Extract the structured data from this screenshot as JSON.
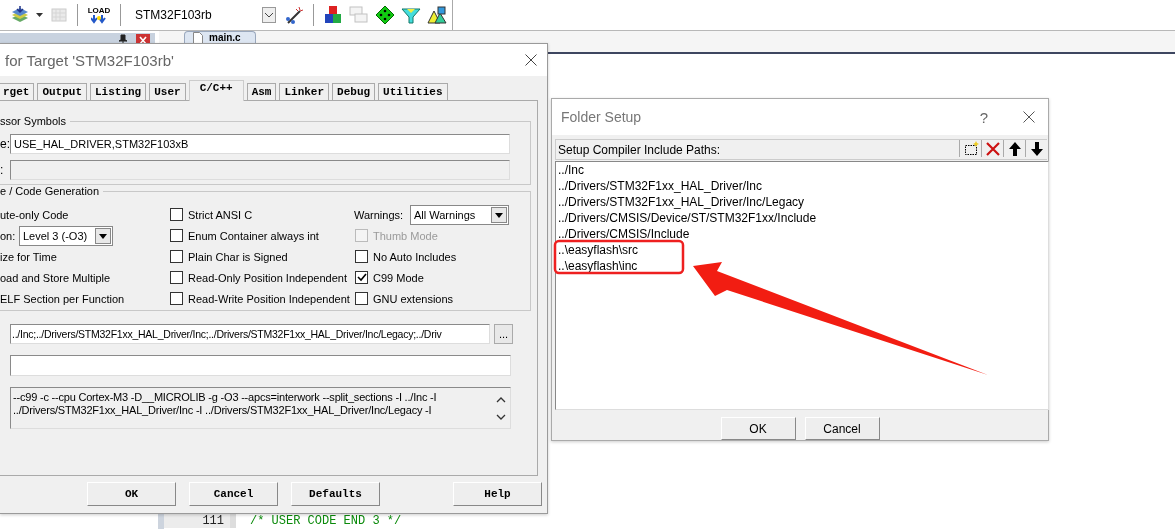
{
  "toolbar": {
    "load_label": "LOAD",
    "device": "STM32F103rb"
  },
  "editor": {
    "tabs": [
      {
        "label": "main.c"
      }
    ],
    "lines": [
      {
        "number": "111",
        "code": "/* USER CODE END 3 */"
      }
    ]
  },
  "options_dialog": {
    "title": "for Target 'STM32F103rb'",
    "tabs": [
      {
        "label": "rget",
        "selected": false
      },
      {
        "label": "Output",
        "selected": false
      },
      {
        "label": "Listing",
        "selected": false
      },
      {
        "label": "User",
        "selected": false
      },
      {
        "label": "C/C++",
        "selected": true
      },
      {
        "label": "Asm",
        "selected": false
      },
      {
        "label": "Linker",
        "selected": false
      },
      {
        "label": "Debug",
        "selected": false
      },
      {
        "label": "Utilities",
        "selected": false
      }
    ],
    "preprocessor": {
      "title": "ssor Symbols",
      "fields": [
        {
          "label": "e:",
          "value": "USE_HAL_DRIVER,STM32F103xB",
          "disabled": false
        },
        {
          "label": ":",
          "disabled": true
        }
      ]
    },
    "code_generation": {
      "title": "e / Code Generation",
      "left": [
        {
          "kind": "text",
          "label": "ute-only Code"
        },
        {
          "kind": "select",
          "label": "on:",
          "value": "Level 3 (-O3)"
        },
        {
          "kind": "text",
          "label": "ize for Time"
        },
        {
          "kind": "text",
          "label": "oad and Store Multiple"
        },
        {
          "kind": "text",
          "label": "ELF Section per Function"
        }
      ],
      "middle": [
        {
          "label": "Strict ANSI C",
          "checked": false,
          "disabled": false
        },
        {
          "label": "Enum Container always int",
          "checked": false,
          "disabled": false
        },
        {
          "label": "Plain Char is Signed",
          "checked": false,
          "disabled": false
        },
        {
          "label": "Read-Only Position Independent",
          "checked": false,
          "disabled": false
        },
        {
          "label": "Read-Write Position Independent",
          "checked": false,
          "disabled": false
        }
      ],
      "warnings": {
        "label": "Warnings:",
        "value": "All Warnings"
      },
      "right": [
        {
          "label": "Thumb Mode",
          "checked": false,
          "disabled": true
        },
        {
          "label": "No Auto Includes",
          "checked": false,
          "disabled": false
        },
        {
          "label": "C99 Mode",
          "checked": true,
          "disabled": false
        },
        {
          "label": "GNU extensions",
          "checked": false,
          "disabled": false
        }
      ]
    },
    "include_paths": {
      "value": "../Inc;../Drivers/STM32F1xx_HAL_Driver/Inc;../Drivers/STM32F1xx_HAL_Driver/Inc/Legacy;../Driv",
      "browse": "..."
    },
    "control_string": [
      "--c99 -c --cpu Cortex-M3 -D__MICROLIB -g -O3 --apcs=interwork --split_sections -I ../Inc -I",
      "../Drivers/STM32F1xx_HAL_Driver/Inc -I ../Drivers/STM32F1xx_HAL_Driver/Inc/Legacy -I"
    ],
    "buttons": [
      "OK",
      "Cancel",
      "Defaults",
      "Help"
    ]
  },
  "folder_dialog": {
    "title": "Folder Setup",
    "help": "?",
    "heading": "Setup Compiler Include Paths:",
    "paths": [
      "../Inc",
      "../Drivers/STM32F1xx_HAL_Driver/Inc",
      "../Drivers/STM32F1xx_HAL_Driver/Inc/Legacy",
      "../Drivers/CMSIS/Device/ST/STM32F1xx/Include",
      "../Drivers/CMSIS/Include",
      "..\\easyflash\\src",
      "..\\easyflash\\inc"
    ],
    "buttons": [
      "OK",
      "Cancel"
    ]
  }
}
